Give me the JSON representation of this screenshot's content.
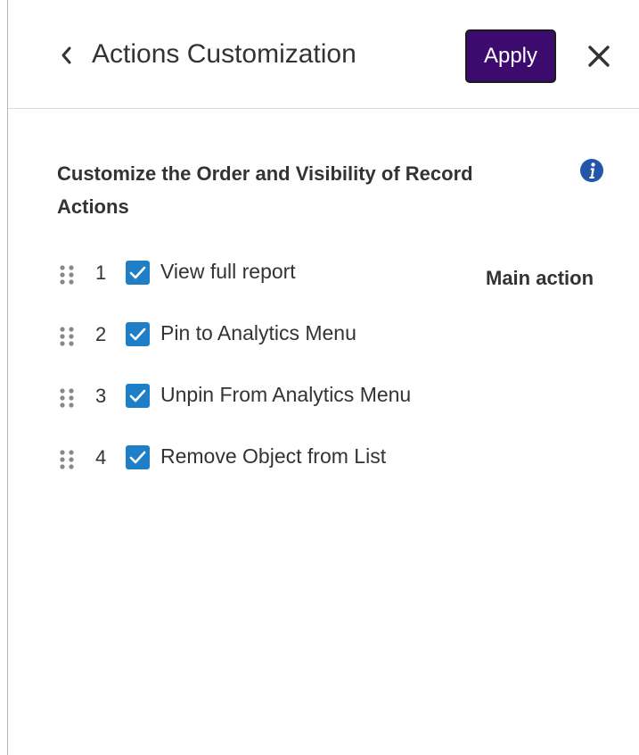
{
  "header": {
    "title": "Actions Customization",
    "apply_label": "Apply",
    "back_icon": "chevron-left-icon",
    "close_icon": "close-icon"
  },
  "section": {
    "heading": "Customize the Order and Visibility of Record Actions",
    "info_icon": "info-icon"
  },
  "actions": [
    {
      "order": "1",
      "label": "View full report",
      "checked": true,
      "badge": "Main action"
    },
    {
      "order": "2",
      "label": "Pin to Analytics Menu",
      "checked": true
    },
    {
      "order": "3",
      "label": "Unpin From Analytics Menu",
      "checked": true
    },
    {
      "order": "4",
      "label": "Remove Object from List",
      "checked": true
    }
  ],
  "colors": {
    "apply_bg": "#3d0a6e",
    "checkbox": "#1f7fc6",
    "info": "#2456a8",
    "text": "#333333"
  }
}
